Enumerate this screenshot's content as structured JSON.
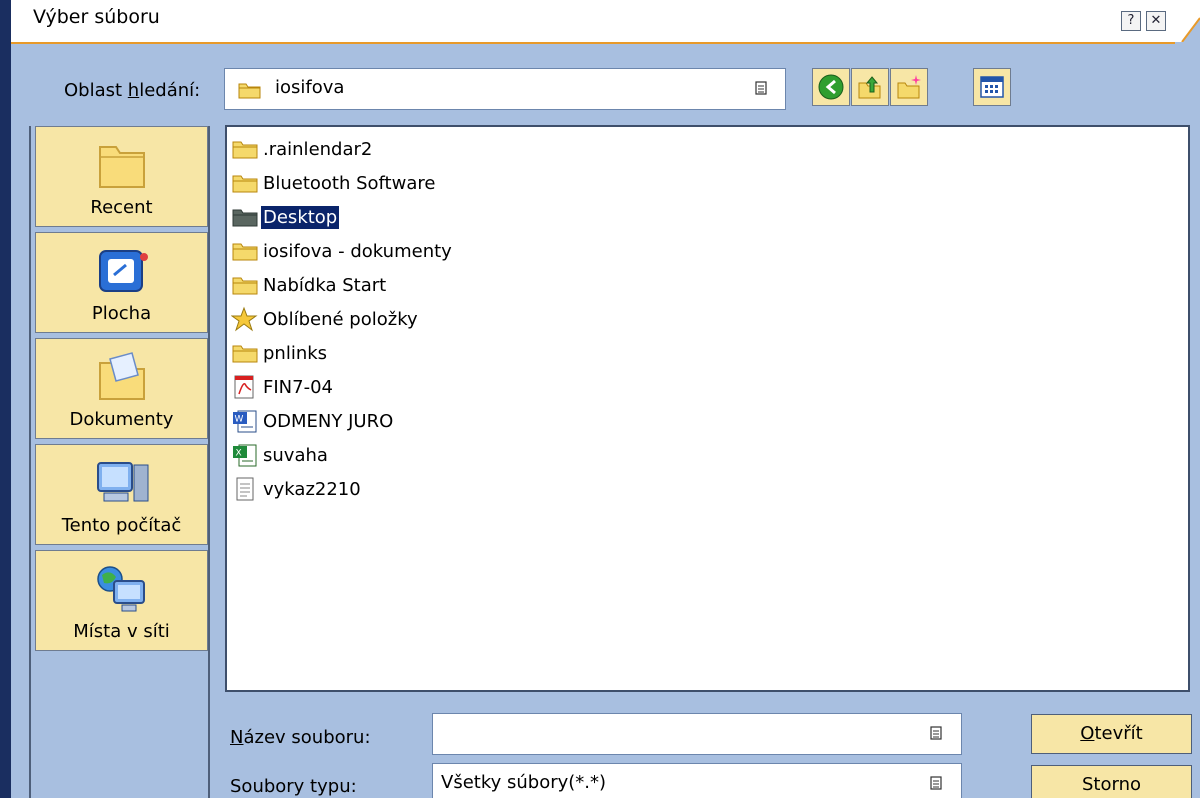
{
  "dialog": {
    "title": "Výber súboru",
    "help_label": "?",
    "close_label": "✕"
  },
  "lookin": {
    "label_pre": "Oblast ",
    "label_u": "h",
    "label_post": "ledání:",
    "value": "iosifova"
  },
  "places": [
    {
      "label": "Recent",
      "icon": "folder-icon"
    },
    {
      "label": "Plocha",
      "icon": "desktop-icon"
    },
    {
      "label": "Dokumenty",
      "icon": "documents-icon"
    },
    {
      "label": "Tento počítač",
      "icon": "computer-icon"
    },
    {
      "label": "Místa v síti",
      "icon": "network-icon"
    }
  ],
  "files": [
    {
      "name": ".rainlendar2",
      "icon": "folder-icon"
    },
    {
      "name": "Bluetooth Software",
      "icon": "folder-icon"
    },
    {
      "name": "Desktop",
      "icon": "folder-icon",
      "selected": true
    },
    {
      "name": "iosifova - dokumenty",
      "icon": "folder-icon"
    },
    {
      "name": "Nabídka Start",
      "icon": "folder-icon"
    },
    {
      "name": "Oblíbené položky",
      "icon": "favorites-star-icon"
    },
    {
      "name": "pnlinks",
      "icon": "folder-icon"
    },
    {
      "name": "FIN7-04",
      "icon": "pdf-icon"
    },
    {
      "name": "ODMENY JURO",
      "icon": "word-doc-icon"
    },
    {
      "name": "suvaha",
      "icon": "excel-icon"
    },
    {
      "name": "vykaz2210",
      "icon": "text-file-icon"
    }
  ],
  "filename": {
    "label_u": "N",
    "label_post": "ázev souboru:",
    "value": ""
  },
  "filetype": {
    "label": "Soubory typu:",
    "value": "Všetky súbory(*.*)"
  },
  "buttons": {
    "open_u": "O",
    "open_post": "tevřít",
    "cancel": "Storno"
  },
  "colors": {
    "background": "#a8bfe0",
    "button_face": "#f7e6a6",
    "selection": "#0a246a",
    "title_accent": "#e89a2a"
  }
}
